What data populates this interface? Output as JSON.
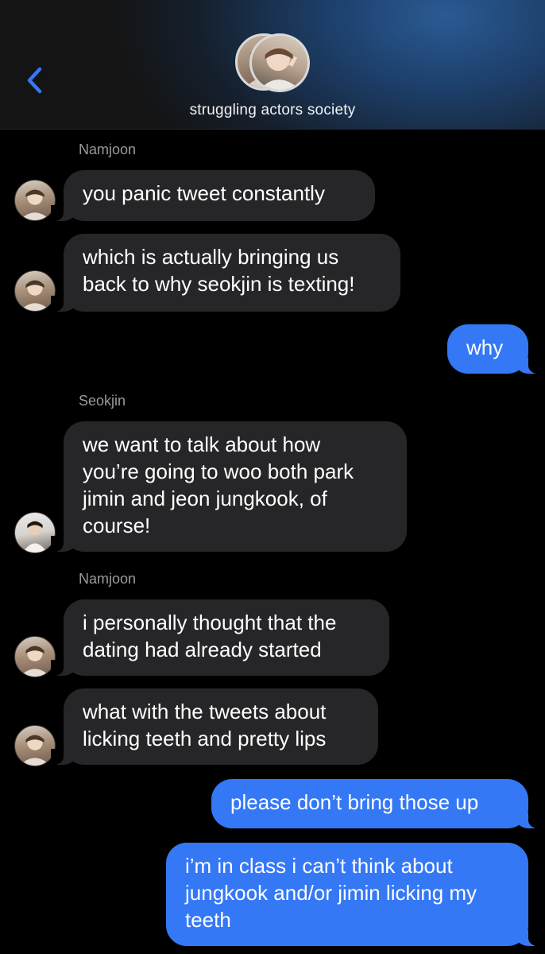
{
  "header": {
    "chat_name": "struggling actors society",
    "back_icon": "chevron-left-icon",
    "accent": "#3478f6",
    "background_gradient": [
      "#2a5a94",
      "#141414"
    ]
  },
  "thread": {
    "incoming_bubble_color": "#262628",
    "outgoing_bubble_color": "#3478f6",
    "senders": {
      "namjoon_1": "Namjoon",
      "seokjin": "Seokjin",
      "namjoon_2": "Namjoon"
    },
    "messages": [
      {
        "from": "Namjoon",
        "text": "you panic tweet constantly"
      },
      {
        "from": "Namjoon",
        "text": "which is actually bringing us\nback to why seokjin is texting!"
      },
      {
        "from": "me",
        "text": "why"
      },
      {
        "from": "Seokjin",
        "text": "we want to talk about how\nyou’re going to woo both park\njimin and jeon jungkook, of\ncourse!"
      },
      {
        "from": "Namjoon",
        "text": "i personally thought that the\ndating had already started"
      },
      {
        "from": "Namjoon",
        "text": "what with the tweets about\nlicking teeth and pretty lips"
      },
      {
        "from": "me",
        "text": "please don’t bring those up"
      },
      {
        "from": "me",
        "text": "i’m in class i can’t think about\njungkook and/or jimin licking my\nteeth"
      }
    ]
  }
}
